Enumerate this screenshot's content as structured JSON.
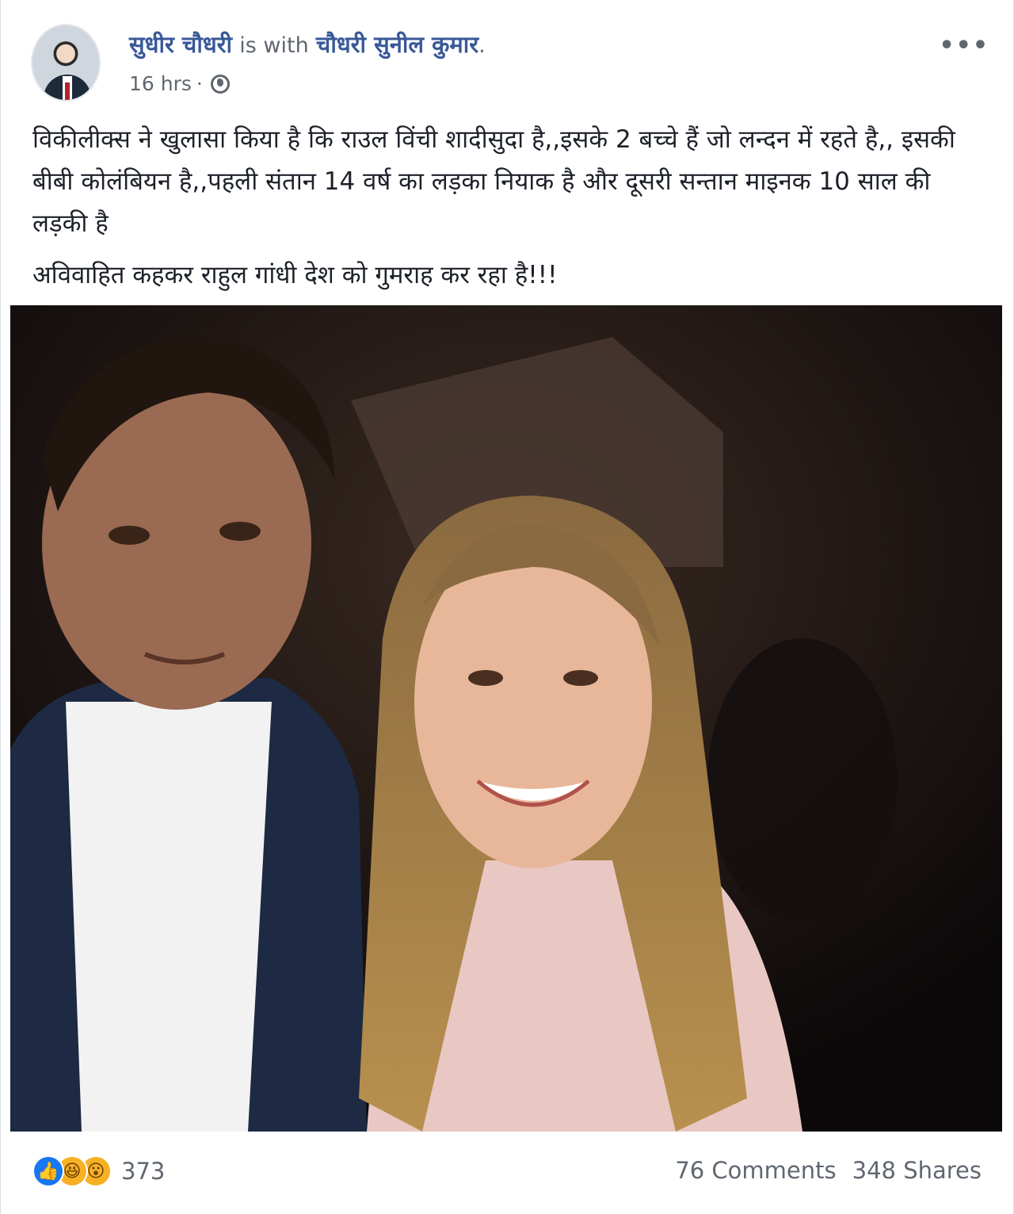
{
  "post": {
    "author": "सुधीर चौधरी",
    "with_text": "is with",
    "tagged": "चौधरी सुनील कुमार",
    "period": ".",
    "timestamp": "16 hrs",
    "separator": "·",
    "privacy_icon": "globe-icon",
    "more_icon": "more-options-icon",
    "more_glyph": "•••",
    "paragraphs": [
      "विकीलीक्स ने खुलासा किया है कि राउल विंची शादीसुदा है,,इसके 2 बच्चे हैं जो लन्दन में रहते है,, इसकी बीबी कोलंबियन है,,पहली संतान 14 वर्ष का लड़का नियाक है और दूसरी सन्तान माइनक 10 साल की लड़की है",
      "अविवाहित कहकर राहुल गांधी देश को गुमराह कर रहा है!!!"
    ]
  },
  "footer": {
    "reactions": [
      "like-icon",
      "haha-icon",
      "wow-icon"
    ],
    "reaction_count": "373",
    "comments": "76 Comments",
    "shares": "348 Shares"
  },
  "colors": {
    "link": "#385898",
    "meta": "#606770",
    "like": "#1877f2",
    "emoji": "#f7b125"
  }
}
